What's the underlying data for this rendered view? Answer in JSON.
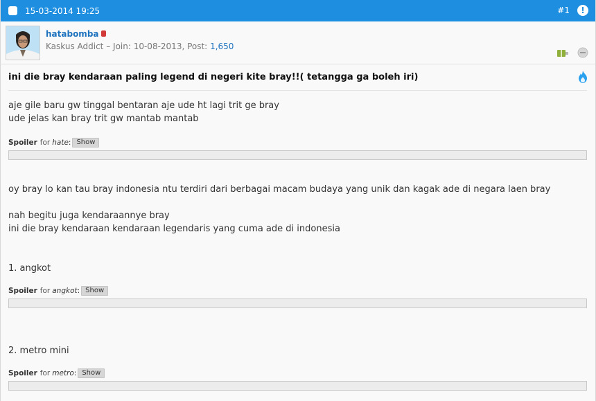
{
  "header": {
    "date": "15-03-2014 19:25",
    "post_number": "#1",
    "alert_icon": "!"
  },
  "user": {
    "name": "hatabomba",
    "rank": "Kaskus Addict",
    "join_text": "– Join: 10-08-2013, Post:",
    "post_count": "1,650"
  },
  "post": {
    "title": "ini die bray kendaraan paling legend di negeri kite bray!!( tetangga ga boleh iri)",
    "intro_lines": [
      "aje gile baru gw tinggal bentaran aje ude ht lagi trit ge bray",
      "ude jelas kan bray trit gw mantab mantab"
    ],
    "spoilers": [
      {
        "label": "Spoiler",
        "for": "for",
        "name": "hate",
        "button": "Show"
      },
      {
        "label": "Spoiler",
        "for": "for",
        "name": "angkot",
        "button": "Show"
      },
      {
        "label": "Spoiler",
        "for": "for",
        "name": "metro",
        "button": "Show"
      }
    ],
    "body_line_1": "oy bray lo kan tau bray indonesia ntu terdiri dari berbagai macam budaya yang unik dan kagak ade di negara laen bray",
    "body_line_2": "nah begitu juga kendaraannye bray",
    "body_line_3": "ini die bray kendaraan kendaraan legendaris yang cuma ade di indonesia",
    "item_1": "1. angkot",
    "item_2": "2. metro mini"
  },
  "icons": {
    "checkbox": "checkbox-icon",
    "alert": "alert-icon",
    "gift": "gift-icon",
    "ignore": "ignore-icon",
    "hot": "fire-icon"
  },
  "colors": {
    "header_blue": "#1e8fe0",
    "link_blue": "#1e73be"
  }
}
